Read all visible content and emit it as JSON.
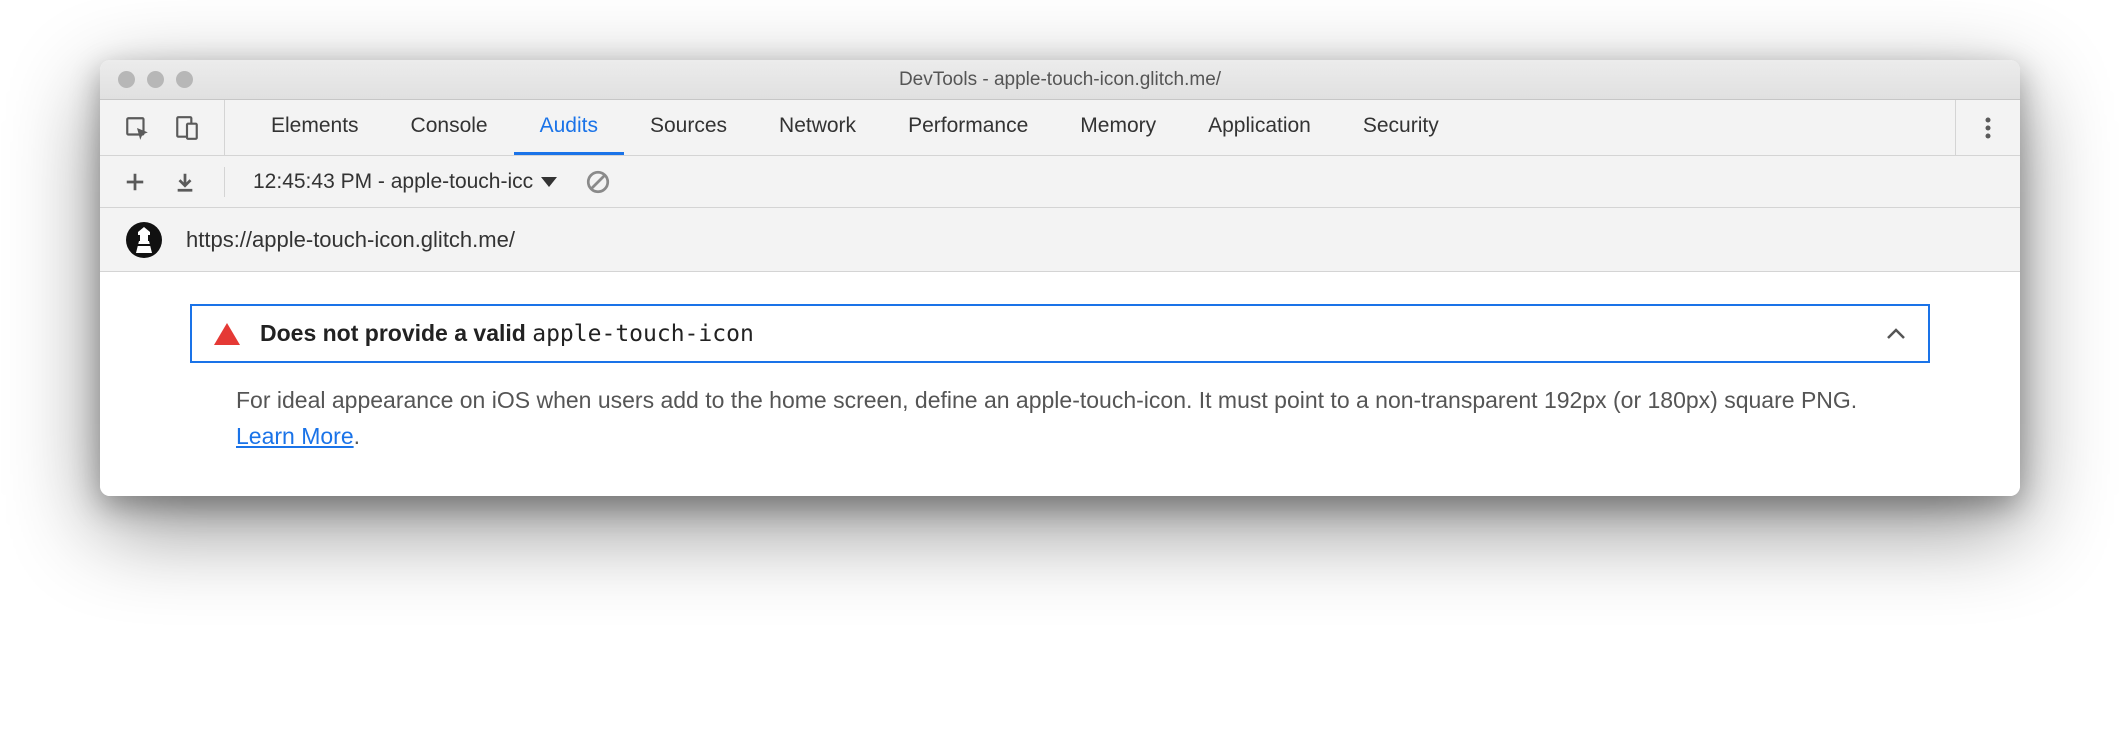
{
  "window": {
    "title": "DevTools - apple-touch-icon.glitch.me/"
  },
  "tabs": [
    "Elements",
    "Console",
    "Audits",
    "Sources",
    "Network",
    "Performance",
    "Memory",
    "Application",
    "Security"
  ],
  "active_tab_index": 2,
  "audits_toolbar": {
    "report_label": "12:45:43 PM - apple-touch-icc"
  },
  "url_bar": {
    "url": "https://apple-touch-icon.glitch.me/"
  },
  "audit": {
    "title_prefix": "Does not provide a valid ",
    "title_code": "apple-touch-icon",
    "description_before_link": "For ideal appearance on iOS when users add to the home screen, define an apple-touch-icon. It must point to a non-transparent 192px (or 180px) square PNG. ",
    "link_text": "Learn More",
    "description_after_link": "."
  }
}
